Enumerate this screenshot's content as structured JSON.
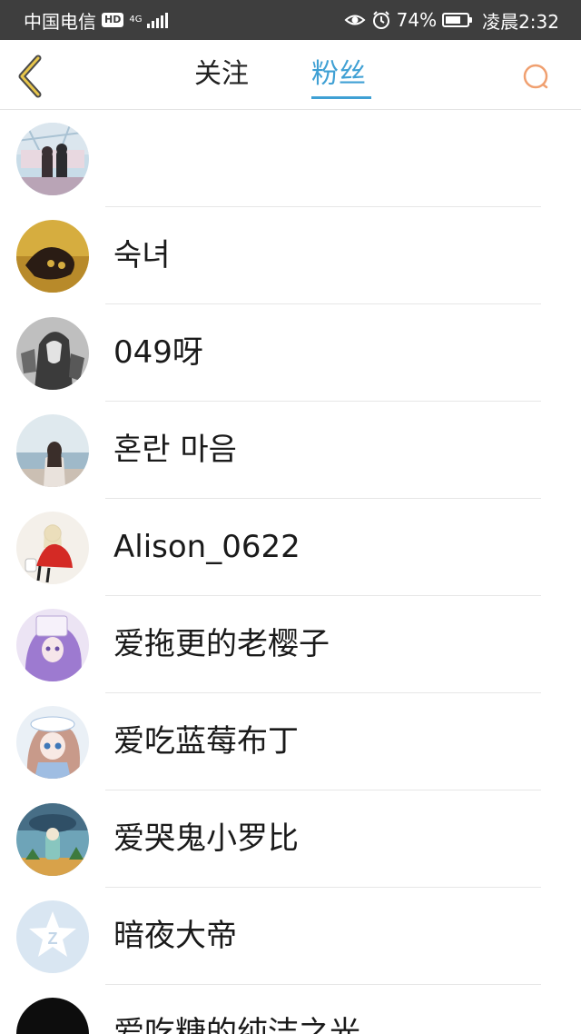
{
  "status_bar": {
    "carrier": "中国电信",
    "hd": "HD",
    "network": "4G",
    "battery_percent": "74%",
    "battery_level": 0.74,
    "time": "凌晨2:32"
  },
  "header": {
    "tabs": [
      {
        "label": "关注",
        "active": false
      },
      {
        "label": "粉丝",
        "active": true
      }
    ],
    "accent_color": "#3fa0d4",
    "back_icon": "chevron-left-icon",
    "search_icon": "search-icon"
  },
  "fans": [
    {
      "name": "",
      "avatar": "avatar-amusement-park-couple"
    },
    {
      "name": "숙녀",
      "avatar": "avatar-dark-hands"
    },
    {
      "name": "049呀",
      "avatar": "avatar-gray-anime-hood"
    },
    {
      "name": "혼란 마음",
      "avatar": "avatar-girl-sea"
    },
    {
      "name": "Alison_0622",
      "avatar": "avatar-red-coat-drawing"
    },
    {
      "name": "爱拖更的老樱子",
      "avatar": "avatar-purple-anime"
    },
    {
      "name": "爱吃蓝莓布丁",
      "avatar": "avatar-blue-anime-girl"
    },
    {
      "name": "爱哭鬼小罗比",
      "avatar": "avatar-rainy-cartoon"
    },
    {
      "name": "暗夜大帝",
      "avatar": "avatar-default-qq"
    },
    {
      "name": "爱吃糖的纯洁之光",
      "avatar": "avatar-black"
    }
  ]
}
